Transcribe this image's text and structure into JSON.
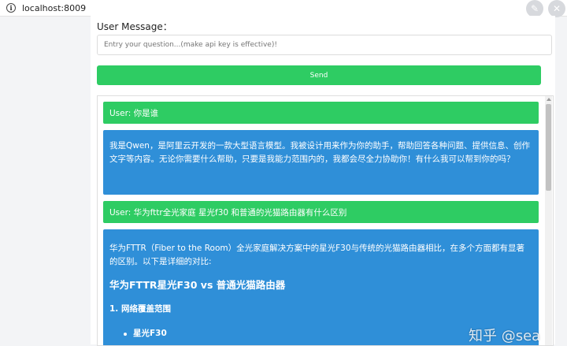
{
  "browser": {
    "url": "localhost:8009",
    "info_icon": "info-icon",
    "edit_icon": "edit-icon",
    "close_icon": "close-icon"
  },
  "form": {
    "label": "User Message：",
    "placeholder": "Entry your question...(make api key is effective)!",
    "send_label": "Send"
  },
  "chat": {
    "user_message_1": "User: 你是谁",
    "bot_message_1": "我是Qwen，是阿里云开发的一款大型语言模型。我被设计用来作为你的助手，帮助回答各种问题、提供信息、创作文字等内容。无论你需要什么帮助，只要是我能力范围内的，我都会尽全力协助你！有什么我可以帮到你的吗？",
    "user_message_2": "User: 华为fttr全光家庭 星光f30 和普通的光猫路由器有什么区别",
    "bot_message_2": {
      "intro": "华为FTTR（Fiber to the Room）全光家庭解决方案中的星光F30与传统的光猫路由器相比，在多个方面都有显著的区别。以下是详细的对比:",
      "heading": "华为FTTR星光F30 vs 普通光猫路由器",
      "section_1": "1. 网络覆盖范围",
      "bullet_1": "星光F30"
    }
  },
  "watermark": "知乎 @sea",
  "colors": {
    "user_bubble": "#2ecc63",
    "bot_bubble": "#2f8fd8",
    "send_button": "#2ecc63"
  }
}
